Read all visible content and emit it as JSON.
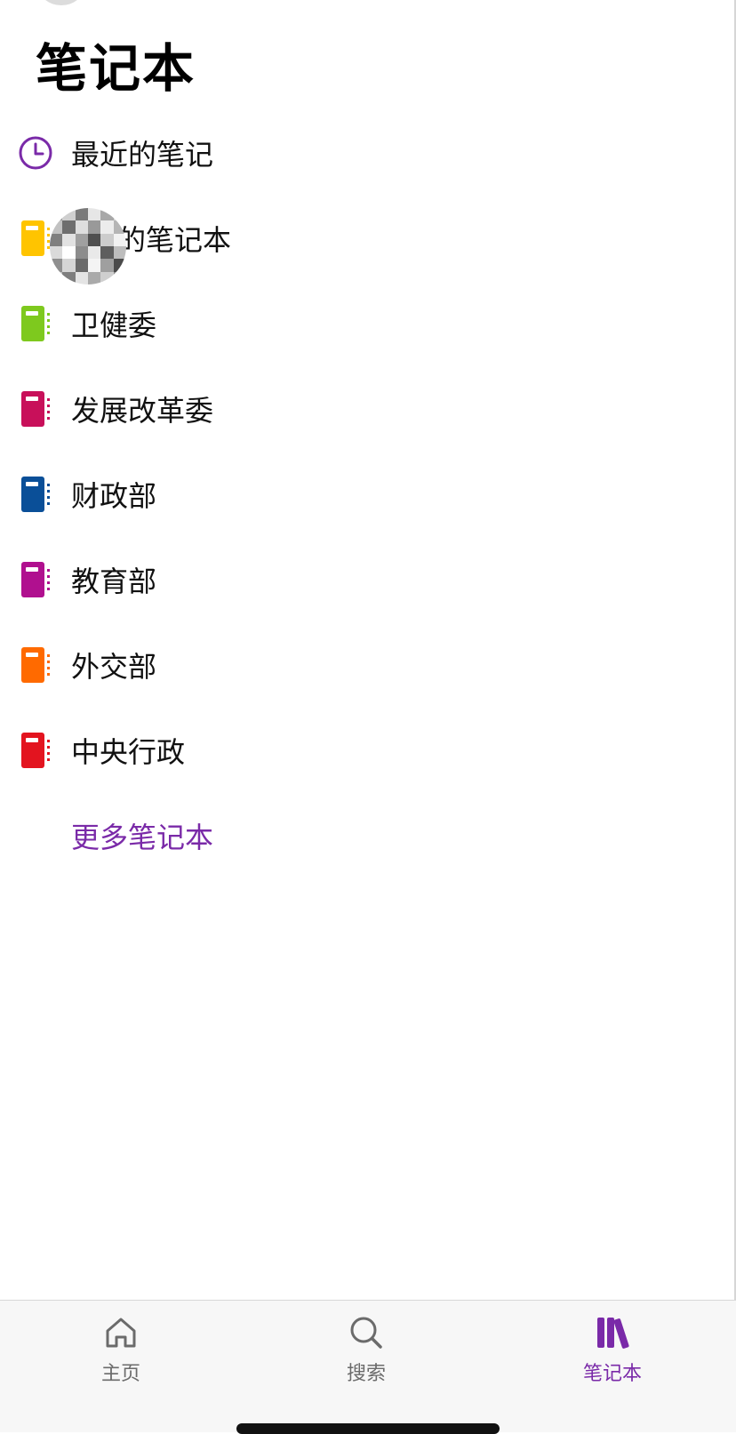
{
  "page": {
    "title": "笔记本"
  },
  "list": [
    {
      "label": "最近的笔记",
      "icon": "clock-icon",
      "color": "#7a2aa8"
    },
    {
      "label": "的笔记本",
      "icon": "notebook-icon",
      "color": "#ffc400"
    },
    {
      "label": "卫健委",
      "icon": "notebook-icon",
      "color": "#7ec91e"
    },
    {
      "label": "发展改革委",
      "icon": "notebook-icon",
      "color": "#c8105a"
    },
    {
      "label": "财政部",
      "icon": "notebook-icon",
      "color": "#0a4f98"
    },
    {
      "label": "教育部",
      "icon": "notebook-icon",
      "color": "#b0108f"
    },
    {
      "label": "外交部",
      "icon": "notebook-icon",
      "color": "#ff6a00"
    },
    {
      "label": "中央行政",
      "icon": "notebook-icon",
      "color": "#e3141f"
    }
  ],
  "more_link": "更多笔记本",
  "tabbar": {
    "home": {
      "label": "主页",
      "icon": "home-icon"
    },
    "search": {
      "label": "搜索",
      "icon": "search-icon"
    },
    "notebooks": {
      "label": "笔记本",
      "icon": "library-icon",
      "active": true
    }
  },
  "colors": {
    "accent": "#7a2aa8",
    "inactive": "#6b6b6b"
  }
}
